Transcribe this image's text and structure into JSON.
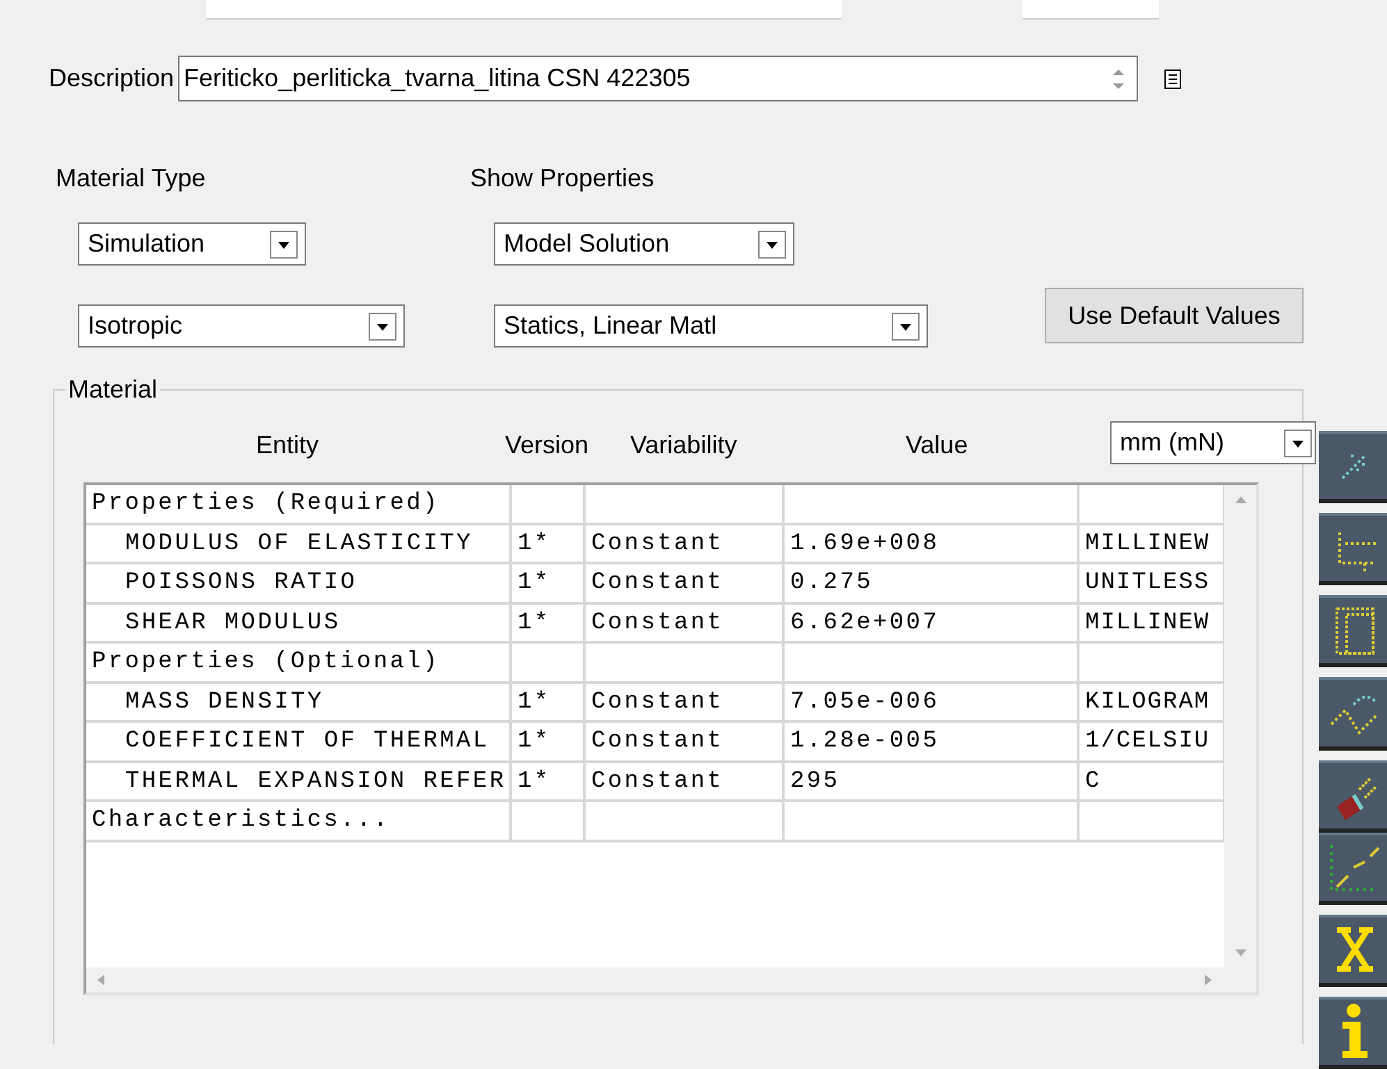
{
  "description": {
    "label": "Description",
    "value": "Feriticko_perliticka_tvarna_litina CSN 422305"
  },
  "material_type": {
    "label": "Material Type",
    "dropdowns": [
      "Simulation",
      "Isotropic"
    ]
  },
  "show_properties": {
    "label": "Show Properties",
    "dropdowns": [
      "Model Solution",
      "Statics, Linear Matl"
    ]
  },
  "default_button": "Use Default Values",
  "material": {
    "title": "Material",
    "columns": [
      "Entity",
      "Version",
      "Variability",
      "Value"
    ],
    "units": "mm (mN)",
    "rows": [
      {
        "kind": "group",
        "entity": "Properties (Required)"
      },
      {
        "kind": "property",
        "entity": "MODULUS OF ELASTICITY",
        "version": "1*",
        "variability": "Constant",
        "value": "1.69e+008",
        "units": "MILLINEW"
      },
      {
        "kind": "property",
        "entity": "POISSONS RATIO",
        "version": "1*",
        "variability": "Constant",
        "value": "0.275",
        "units": "UNITLESS"
      },
      {
        "kind": "property",
        "entity": "SHEAR MODULUS",
        "version": "1*",
        "variability": "Constant",
        "value": "6.62e+007",
        "units": "MILLINEW"
      },
      {
        "kind": "group",
        "entity": "Properties (Optional)"
      },
      {
        "kind": "property",
        "entity": "MASS DENSITY",
        "version": "1*",
        "variability": "Constant",
        "value": "7.05e-006",
        "units": "KILOGRAM"
      },
      {
        "kind": "property",
        "entity": "COEFFICIENT OF THERMAL",
        "version": "1*",
        "variability": "Constant",
        "value": "1.28e-005",
        "units": "1/CELSIU"
      },
      {
        "kind": "property",
        "entity": "THERMAL EXPANSION REFER",
        "version": "1*",
        "variability": "Constant",
        "value": "295",
        "units": "C"
      },
      {
        "kind": "group",
        "entity": "Characteristics..."
      }
    ]
  }
}
